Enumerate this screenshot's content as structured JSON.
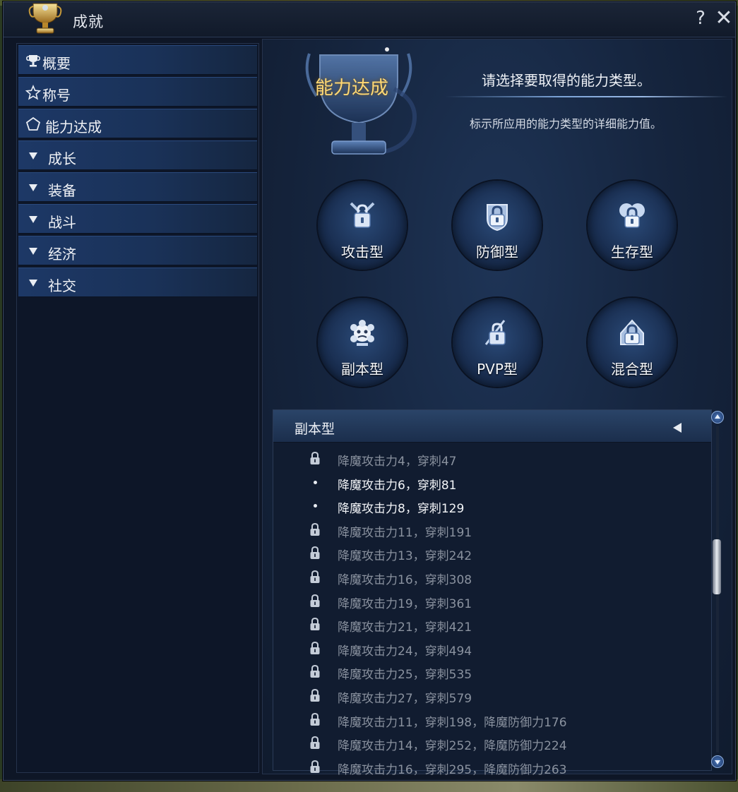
{
  "window": {
    "title": "成就",
    "help_label": "?",
    "close_label": "✕"
  },
  "sidebar": {
    "items": [
      {
        "label": "概要",
        "icon": "trophy-icon",
        "kind": "page"
      },
      {
        "label": "称号",
        "icon": "star-icon",
        "kind": "page"
      },
      {
        "label": "能力达成",
        "icon": "pentagon-icon",
        "kind": "page"
      },
      {
        "label": "成长",
        "icon": "triangle-down-icon",
        "kind": "category"
      },
      {
        "label": "装备",
        "icon": "triangle-down-icon",
        "kind": "category"
      },
      {
        "label": "战斗",
        "icon": "triangle-down-icon",
        "kind": "category"
      },
      {
        "label": "经济",
        "icon": "triangle-down-icon",
        "kind": "category"
      },
      {
        "label": "社交",
        "icon": "triangle-down-icon",
        "kind": "category"
      }
    ]
  },
  "header": {
    "title": "能力达成",
    "subtitle": "请选择要取得的能力类型。",
    "description": "标示所应用的能力类型的详细能力值。"
  },
  "types": [
    {
      "label": "攻击型",
      "icon": "attack-lock-icon"
    },
    {
      "label": "防御型",
      "icon": "defense-lock-icon"
    },
    {
      "label": "生存型",
      "icon": "survival-lock-icon"
    },
    {
      "label": "副本型",
      "icon": "dungeon-emblem-icon"
    },
    {
      "label": "PVP型",
      "icon": "pvp-lock-icon"
    },
    {
      "label": "混合型",
      "icon": "mixed-lock-icon"
    }
  ],
  "list": {
    "title": "副本型",
    "rows": [
      {
        "text": "降魔攻击力4，穿刺47",
        "locked": true
      },
      {
        "text": "降魔攻击力6，穿刺81",
        "locked": false
      },
      {
        "text": "降魔攻击力8，穿刺129",
        "locked": false
      },
      {
        "text": "降魔攻击力11，穿刺191",
        "locked": true
      },
      {
        "text": "降魔攻击力13，穿刺242",
        "locked": true
      },
      {
        "text": "降魔攻击力16，穿刺308",
        "locked": true
      },
      {
        "text": "降魔攻击力19，穿刺361",
        "locked": true
      },
      {
        "text": "降魔攻击力21，穿刺421",
        "locked": true
      },
      {
        "text": "降魔攻击力24，穿刺494",
        "locked": true
      },
      {
        "text": "降魔攻击力25，穿刺535",
        "locked": true
      },
      {
        "text": "降魔攻击力27，穿刺579",
        "locked": true
      },
      {
        "text": "降魔攻击力11，穿刺198，降魔防御力176",
        "locked": true
      },
      {
        "text": "降魔攻击力14，穿刺252，降魔防御力224",
        "locked": true
      },
      {
        "text": "降魔攻击力16，穿刺295，降魔防御力263",
        "locked": true
      }
    ]
  },
  "colors": {
    "accent_gold": "#ffd873",
    "locked_text": "#8a929f",
    "unlocked_text": "#f3f5f8",
    "sidebar_item": "#1d3866"
  }
}
